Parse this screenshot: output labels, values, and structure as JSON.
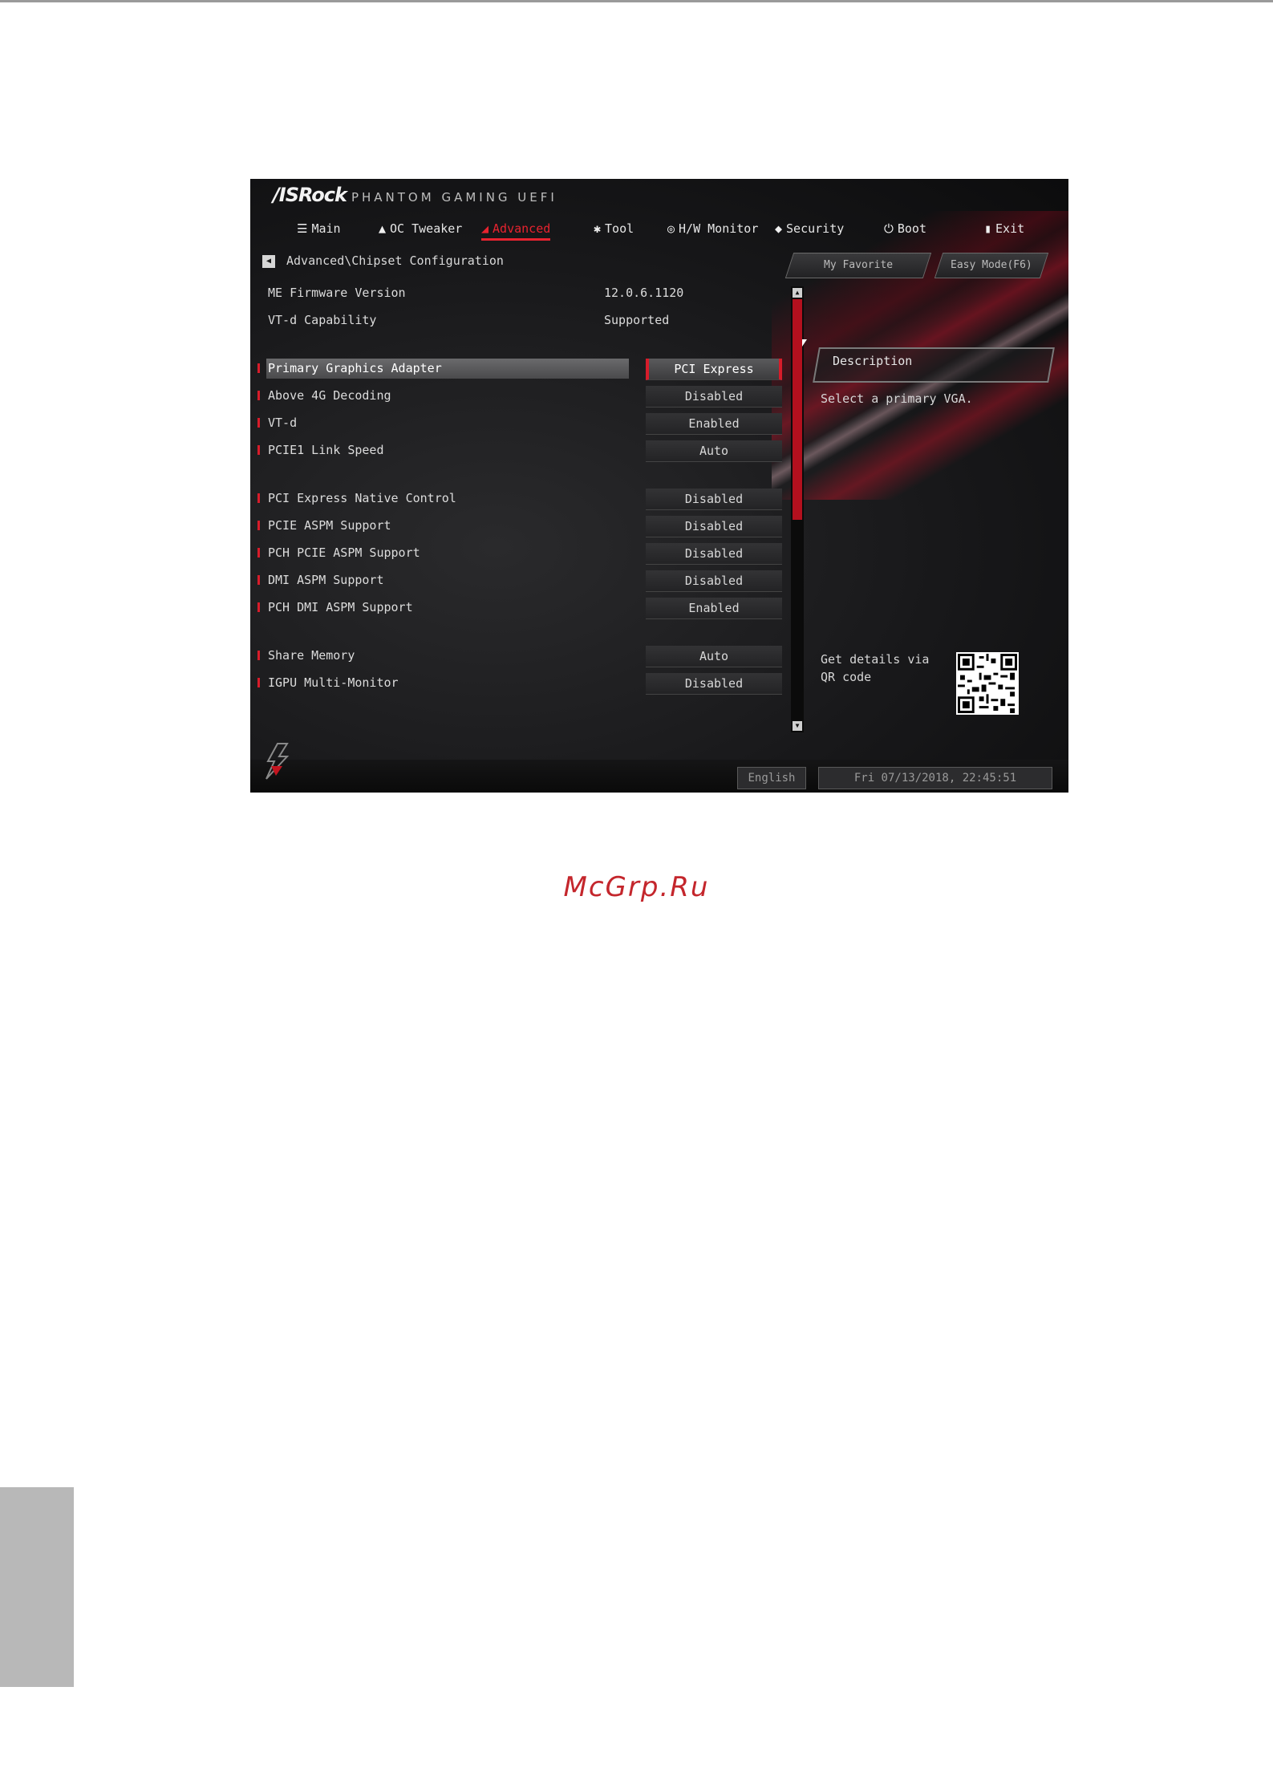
{
  "page": {
    "watermark": "McGrp.Ru"
  },
  "bios": {
    "brand": "/ISRock",
    "brand_sub": "PHANTOM GAMING UEFI",
    "accent_color": "#e8232f",
    "tabs": [
      {
        "label": "Main",
        "icon": "list-icon"
      },
      {
        "label": "OC Tweaker",
        "icon": "flame-icon"
      },
      {
        "label": "Advanced",
        "icon": "advanced-icon",
        "active": true
      },
      {
        "label": "Tool",
        "icon": "tool-icon"
      },
      {
        "label": "H/W Monitor",
        "icon": "monitor-icon"
      },
      {
        "label": "Security",
        "icon": "shield-icon"
      },
      {
        "label": "Boot",
        "icon": "power-icon"
      },
      {
        "label": "Exit",
        "icon": "exit-icon"
      }
    ],
    "breadcrumb": "Advanced\\Chipset Configuration",
    "favorite_button": "My Favorite",
    "easy_mode_button": "Easy Mode(F6)",
    "info": [
      {
        "label": "ME Firmware Version",
        "value": "12.0.6.1120"
      },
      {
        "label": "VT-d Capability",
        "value": "Supported"
      }
    ],
    "settings": [
      {
        "label": "Primary Graphics Adapter",
        "value": "PCI Express",
        "selected": true
      },
      {
        "label": "Above 4G Decoding",
        "value": "Disabled"
      },
      {
        "label": "VT-d",
        "value": "Enabled"
      },
      {
        "label": "PCIE1 Link Speed",
        "value": "Auto"
      },
      {
        "label": "PCI Express Native Control",
        "value": "Disabled"
      },
      {
        "label": "PCIE ASPM Support",
        "value": "Disabled"
      },
      {
        "label": "PCH PCIE ASPM Support",
        "value": "Disabled"
      },
      {
        "label": "DMI ASPM Support",
        "value": "Disabled"
      },
      {
        "label": "PCH DMI ASPM Support",
        "value": "Enabled"
      },
      {
        "label": "Share Memory",
        "value": "Auto"
      },
      {
        "label": "IGPU Multi-Monitor",
        "value": "Disabled"
      }
    ],
    "description_title": "Description",
    "description_text": "Select a primary VGA.",
    "qr_text": "Get details via QR code",
    "language": "English",
    "datetime": "Fri 07/13/2018, 22:45:51"
  }
}
